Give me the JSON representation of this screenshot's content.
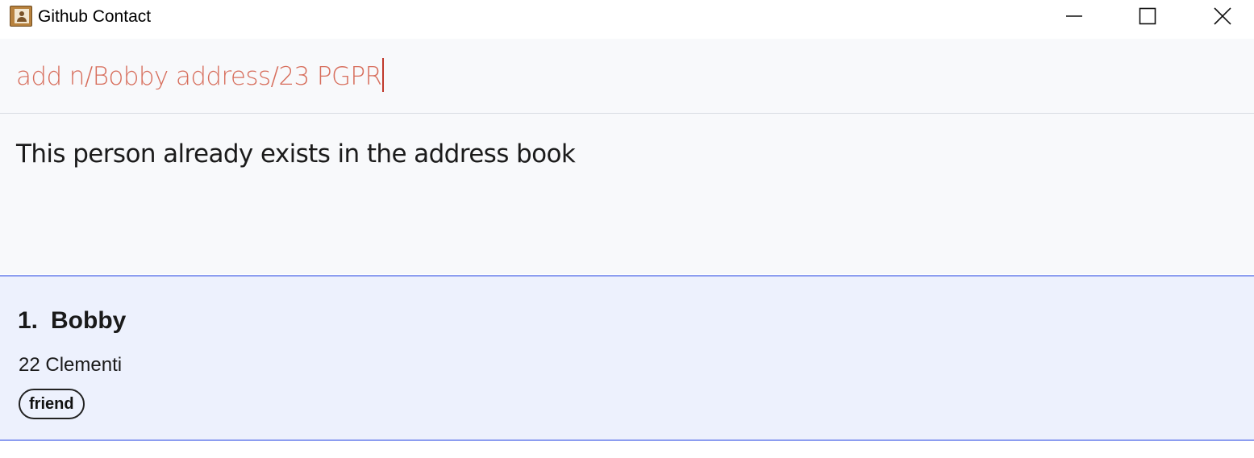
{
  "window": {
    "title": "Github Contact",
    "controls": {
      "minimize_icon": "minimize-icon",
      "maximize_icon": "maximize-icon",
      "close_icon": "close-icon"
    }
  },
  "command_box": {
    "value": "add n/Bobby address/23 PGPR",
    "text_color": "#d76e5c"
  },
  "result_display": {
    "message": "This person already exists in the address book"
  },
  "person_list": {
    "persons": [
      {
        "index": "1.",
        "name": "Bobby",
        "address": "22 Clementi",
        "tags": [
          "friend"
        ]
      }
    ],
    "selected_index": 0,
    "card_background": "#edf1fd",
    "card_border": "#8c9df0"
  }
}
